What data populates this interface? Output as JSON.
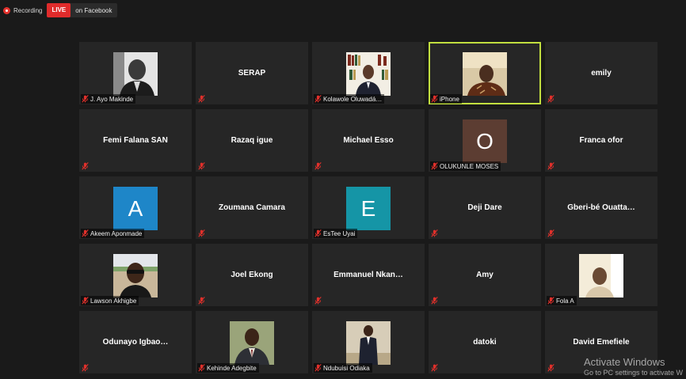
{
  "topbar": {
    "recording_label": "Recording",
    "live_label": "LIVE",
    "destination": "on Facebook"
  },
  "tiles": [
    {
      "name": "J. Ayo Makinde",
      "display": "photo",
      "photo": "man-bw"
    },
    {
      "name": "SERAP",
      "display": "name"
    },
    {
      "name": "Kolawole Oluwadá…",
      "display": "photo",
      "photo": "man-library"
    },
    {
      "name": "iPhone",
      "display": "photo",
      "photo": "man-video",
      "active": true
    },
    {
      "name": "emily",
      "display": "name"
    },
    {
      "name": "Femi Falana SAN",
      "display": "name"
    },
    {
      "name": "Razaq igue",
      "display": "name"
    },
    {
      "name": "Michael Esso",
      "display": "name"
    },
    {
      "name": "OLUKUNLE MOSES",
      "display": "initial",
      "initial": "O",
      "color": "#5c3d32"
    },
    {
      "name": "Franca ofor",
      "display": "name"
    },
    {
      "name": "Akeem Aponmade",
      "display": "initial",
      "initial": "A",
      "color": "#1e86c8"
    },
    {
      "name": "Zoumana Camara",
      "display": "name"
    },
    {
      "name": "EsTee Uyai",
      "display": "initial",
      "initial": "E",
      "color": "#1595a6"
    },
    {
      "name": "Deji Dare",
      "display": "name"
    },
    {
      "name": "Gberi-bé  Ouatta…",
      "display": "name"
    },
    {
      "name": "Lawson Akhigbe",
      "display": "photo",
      "photo": "man-sunglasses"
    },
    {
      "name": "Joel Ekong",
      "display": "name"
    },
    {
      "name": "Emmanuel  Nkan…",
      "display": "name"
    },
    {
      "name": "Amy",
      "display": "name"
    },
    {
      "name": "Fola A",
      "display": "photo",
      "photo": "man-light"
    },
    {
      "name": "Odunayo  Igbao…",
      "display": "name"
    },
    {
      "name": "Kehinde Adegbite",
      "display": "photo",
      "photo": "man-suit-green"
    },
    {
      "name": "Ndubuisi Odiaka",
      "display": "photo",
      "photo": "man-suit-stand"
    },
    {
      "name": "datoki",
      "display": "name"
    },
    {
      "name": "David Emefiele",
      "display": "name"
    }
  ],
  "watermark": {
    "title": "Activate Windows",
    "subtitle": "Go to PC settings to activate W"
  },
  "colors": {
    "active_border": "#c2df3f",
    "live": "#e02b2b",
    "tile_bg": "#262626",
    "mute_icon": "#e0302b"
  }
}
